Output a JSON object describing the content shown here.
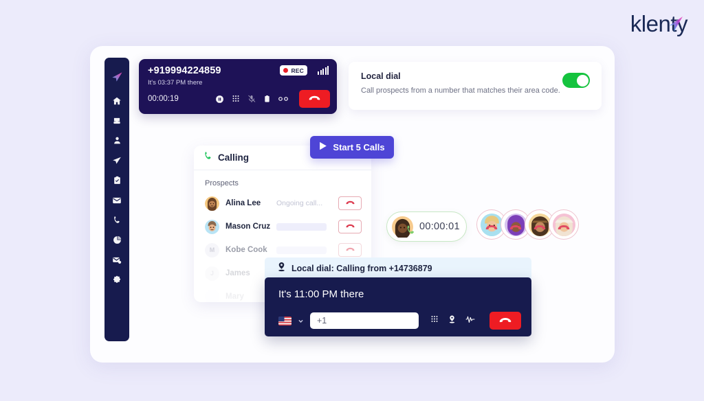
{
  "brand": {
    "name": "klenty",
    "logo_icon": "paper-plane-icon",
    "accent": "#e040a0",
    "text_color": "#1b2a56"
  },
  "background": {
    "page": "#ecebfb",
    "card": "#fdfdff"
  },
  "sidebar": {
    "bg": "#171b4e",
    "items": [
      {
        "icon": "klenty-logo-icon",
        "name": "logo"
      },
      {
        "icon": "home-icon",
        "name": "home"
      },
      {
        "icon": "inbox-icon",
        "name": "inbox"
      },
      {
        "icon": "person-icon",
        "name": "prospects"
      },
      {
        "icon": "paper-plane-icon",
        "name": "cadences"
      },
      {
        "icon": "clipboard-icon",
        "name": "tasks"
      },
      {
        "icon": "envelope-icon",
        "name": "email"
      },
      {
        "icon": "phone-icon",
        "name": "calls"
      },
      {
        "icon": "pie-chart-icon",
        "name": "reports"
      },
      {
        "icon": "mail-badge-icon",
        "name": "notifications"
      },
      {
        "icon": "gear-icon",
        "name": "settings"
      }
    ]
  },
  "call_bar": {
    "number": "+919994224859",
    "local_time": "It's 03:37 PM there",
    "duration": "00:00:19",
    "rec_label": "REC",
    "rec_color": "#e8202a",
    "signal_icon": "signal-bars-icon",
    "actions": [
      {
        "icon": "pause-icon",
        "name": "pause-call"
      },
      {
        "icon": "dialpad-icon",
        "name": "dialpad"
      },
      {
        "icon": "mic-muted-icon",
        "name": "mute"
      },
      {
        "icon": "notes-icon",
        "name": "notes"
      },
      {
        "icon": "voicemail-icon",
        "name": "voicemail"
      }
    ],
    "hangup_icon": "hangup-icon",
    "hangup_color": "#ee1c23"
  },
  "local_dial_card": {
    "title": "Local dial",
    "description": "Call prospects from a number that matches their area code.",
    "toggle_on": true,
    "toggle_color": "#15c33e"
  },
  "calling_panel": {
    "header": "Calling",
    "header_icon": "phone-icon",
    "section_label": "Prospects",
    "rows": [
      {
        "name": "Alina Lee",
        "status": "Ongoing call...",
        "avatar": "avatar-alina",
        "faded": false,
        "bar": false
      },
      {
        "name": "Mason Cruz",
        "status": "",
        "avatar": "avatar-mason",
        "faded": false,
        "bar": true
      },
      {
        "name": "Kobe Cook",
        "status": "",
        "avatar": "avatar-kobe",
        "faded": true,
        "bar": true
      },
      {
        "name": "James",
        "status": "",
        "avatar": "avatar-james",
        "faded": true,
        "bar": false
      },
      {
        "name": "Mary",
        "status": "",
        "avatar": "avatar-mary",
        "faded": true,
        "bar": false
      }
    ],
    "hangup_icon": "hangup-icon"
  },
  "start_button": {
    "label": "Start 5 Calls",
    "icon": "play-icon",
    "color": "#4e45d6"
  },
  "timer_pill": {
    "duration": "00:00:01",
    "avatar": "avatar-caller",
    "badge_icon": "phone-answered-icon",
    "border": "#c7e7c4"
  },
  "avatar_stack": [
    {
      "name": "avatar-1",
      "badge_icon": "hangup-icon"
    },
    {
      "name": "avatar-2",
      "badge_icon": "hangup-icon"
    },
    {
      "name": "avatar-3",
      "badge_icon": "hangup-icon"
    },
    {
      "name": "avatar-4",
      "badge_icon": "hangup-icon"
    }
  ],
  "local_dial_banner": {
    "text": "Local dial: Calling from +14736879",
    "icon": "location-pin-icon"
  },
  "dialer": {
    "local_time": "It's 11:00 PM there",
    "country_flag": "us-flag-icon",
    "chevron_icon": "chevron-down-icon",
    "phone_value": "+1",
    "phone_placeholder": "+1",
    "icons": [
      {
        "icon": "dialpad-icon",
        "name": "dialpad"
      },
      {
        "icon": "location-pin-icon",
        "name": "local-presence"
      },
      {
        "icon": "waveform-icon",
        "name": "call-activity"
      }
    ],
    "hangup_icon": "hangup-icon",
    "hangup_color": "#ee1c23"
  }
}
